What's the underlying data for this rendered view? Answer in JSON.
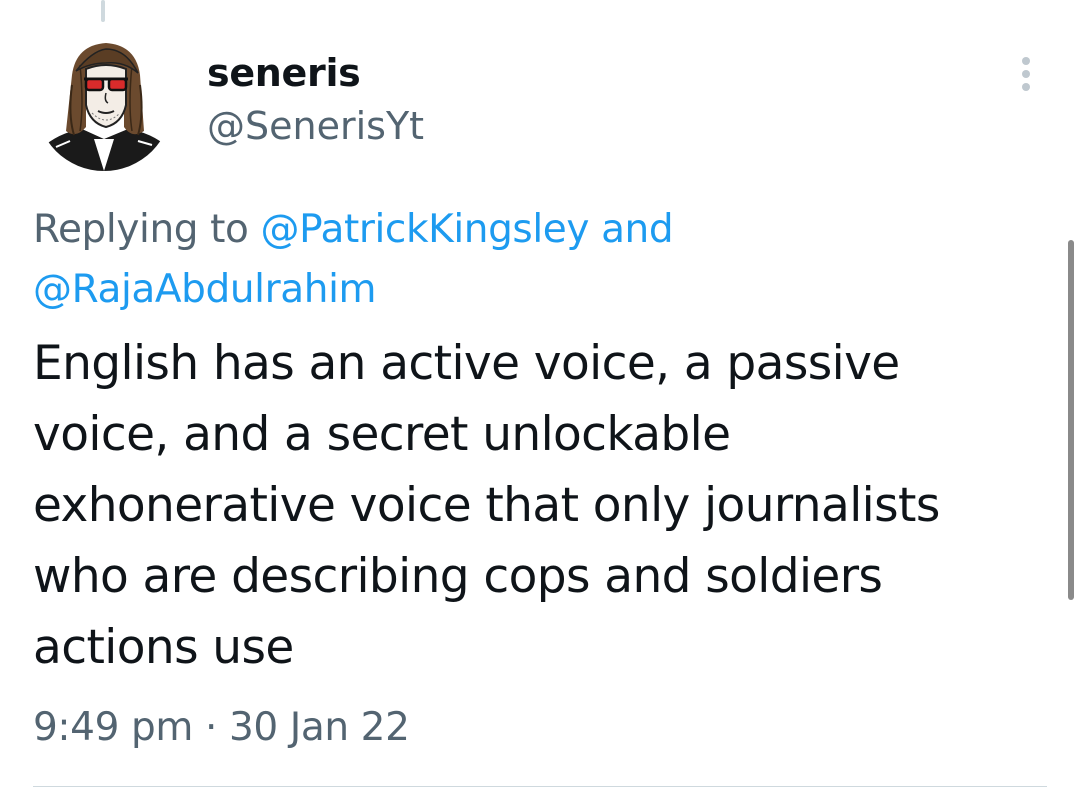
{
  "tweet": {
    "author": {
      "display_name": "seneris",
      "handle": "@SenerisYt",
      "avatar_icon": "cartoon-avatar-long-hair-sunglasses"
    },
    "reply_context": {
      "prefix": "Replying to",
      "mentions": [
        "@PatrickKingsley",
        "@RajaAbdulrahim"
      ],
      "conjunction": "and"
    },
    "text_lines": [
      "English has an active voice, a passive",
      "voice, and a secret unlockable",
      "exhonerative voice that only journalists",
      "who are describing cops and soldiers",
      "actions use"
    ],
    "time": "9:49 pm",
    "separator": "·",
    "date": "30 Jan 22",
    "more_icon": "more-vertical-icon"
  },
  "colors": {
    "text_primary": "#0f1419",
    "text_secondary": "#536471",
    "link": "#1d9bf0",
    "divider": "#cfd9de",
    "scrollbar": "#8a8a8a"
  }
}
